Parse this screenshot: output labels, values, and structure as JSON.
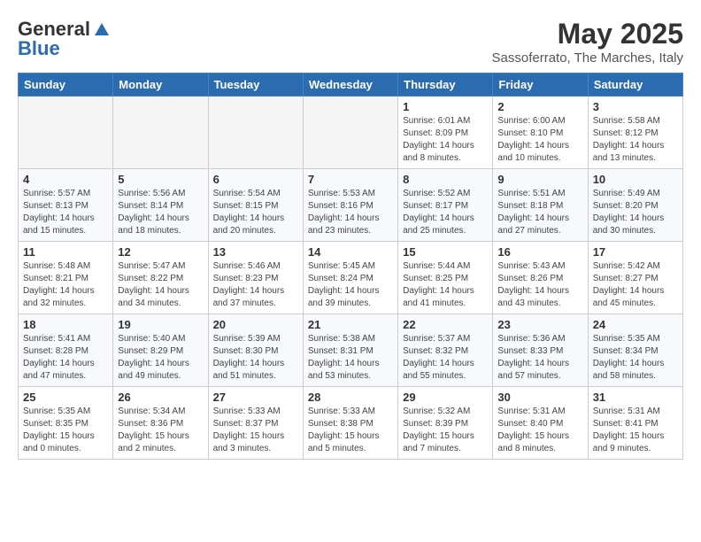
{
  "header": {
    "logo_general": "General",
    "logo_blue": "Blue",
    "month_title": "May 2025",
    "location": "Sassoferrato, The Marches, Italy"
  },
  "days_of_week": [
    "Sunday",
    "Monday",
    "Tuesday",
    "Wednesday",
    "Thursday",
    "Friday",
    "Saturday"
  ],
  "weeks": [
    [
      {
        "day": "",
        "info": ""
      },
      {
        "day": "",
        "info": ""
      },
      {
        "day": "",
        "info": ""
      },
      {
        "day": "",
        "info": ""
      },
      {
        "day": "1",
        "info": "Sunrise: 6:01 AM\nSunset: 8:09 PM\nDaylight: 14 hours\nand 8 minutes."
      },
      {
        "day": "2",
        "info": "Sunrise: 6:00 AM\nSunset: 8:10 PM\nDaylight: 14 hours\nand 10 minutes."
      },
      {
        "day": "3",
        "info": "Sunrise: 5:58 AM\nSunset: 8:12 PM\nDaylight: 14 hours\nand 13 minutes."
      }
    ],
    [
      {
        "day": "4",
        "info": "Sunrise: 5:57 AM\nSunset: 8:13 PM\nDaylight: 14 hours\nand 15 minutes."
      },
      {
        "day": "5",
        "info": "Sunrise: 5:56 AM\nSunset: 8:14 PM\nDaylight: 14 hours\nand 18 minutes."
      },
      {
        "day": "6",
        "info": "Sunrise: 5:54 AM\nSunset: 8:15 PM\nDaylight: 14 hours\nand 20 minutes."
      },
      {
        "day": "7",
        "info": "Sunrise: 5:53 AM\nSunset: 8:16 PM\nDaylight: 14 hours\nand 23 minutes."
      },
      {
        "day": "8",
        "info": "Sunrise: 5:52 AM\nSunset: 8:17 PM\nDaylight: 14 hours\nand 25 minutes."
      },
      {
        "day": "9",
        "info": "Sunrise: 5:51 AM\nSunset: 8:18 PM\nDaylight: 14 hours\nand 27 minutes."
      },
      {
        "day": "10",
        "info": "Sunrise: 5:49 AM\nSunset: 8:20 PM\nDaylight: 14 hours\nand 30 minutes."
      }
    ],
    [
      {
        "day": "11",
        "info": "Sunrise: 5:48 AM\nSunset: 8:21 PM\nDaylight: 14 hours\nand 32 minutes."
      },
      {
        "day": "12",
        "info": "Sunrise: 5:47 AM\nSunset: 8:22 PM\nDaylight: 14 hours\nand 34 minutes."
      },
      {
        "day": "13",
        "info": "Sunrise: 5:46 AM\nSunset: 8:23 PM\nDaylight: 14 hours\nand 37 minutes."
      },
      {
        "day": "14",
        "info": "Sunrise: 5:45 AM\nSunset: 8:24 PM\nDaylight: 14 hours\nand 39 minutes."
      },
      {
        "day": "15",
        "info": "Sunrise: 5:44 AM\nSunset: 8:25 PM\nDaylight: 14 hours\nand 41 minutes."
      },
      {
        "day": "16",
        "info": "Sunrise: 5:43 AM\nSunset: 8:26 PM\nDaylight: 14 hours\nand 43 minutes."
      },
      {
        "day": "17",
        "info": "Sunrise: 5:42 AM\nSunset: 8:27 PM\nDaylight: 14 hours\nand 45 minutes."
      }
    ],
    [
      {
        "day": "18",
        "info": "Sunrise: 5:41 AM\nSunset: 8:28 PM\nDaylight: 14 hours\nand 47 minutes."
      },
      {
        "day": "19",
        "info": "Sunrise: 5:40 AM\nSunset: 8:29 PM\nDaylight: 14 hours\nand 49 minutes."
      },
      {
        "day": "20",
        "info": "Sunrise: 5:39 AM\nSunset: 8:30 PM\nDaylight: 14 hours\nand 51 minutes."
      },
      {
        "day": "21",
        "info": "Sunrise: 5:38 AM\nSunset: 8:31 PM\nDaylight: 14 hours\nand 53 minutes."
      },
      {
        "day": "22",
        "info": "Sunrise: 5:37 AM\nSunset: 8:32 PM\nDaylight: 14 hours\nand 55 minutes."
      },
      {
        "day": "23",
        "info": "Sunrise: 5:36 AM\nSunset: 8:33 PM\nDaylight: 14 hours\nand 57 minutes."
      },
      {
        "day": "24",
        "info": "Sunrise: 5:35 AM\nSunset: 8:34 PM\nDaylight: 14 hours\nand 58 minutes."
      }
    ],
    [
      {
        "day": "25",
        "info": "Sunrise: 5:35 AM\nSunset: 8:35 PM\nDaylight: 15 hours\nand 0 minutes."
      },
      {
        "day": "26",
        "info": "Sunrise: 5:34 AM\nSunset: 8:36 PM\nDaylight: 15 hours\nand 2 minutes."
      },
      {
        "day": "27",
        "info": "Sunrise: 5:33 AM\nSunset: 8:37 PM\nDaylight: 15 hours\nand 3 minutes."
      },
      {
        "day": "28",
        "info": "Sunrise: 5:33 AM\nSunset: 8:38 PM\nDaylight: 15 hours\nand 5 minutes."
      },
      {
        "day": "29",
        "info": "Sunrise: 5:32 AM\nSunset: 8:39 PM\nDaylight: 15 hours\nand 7 minutes."
      },
      {
        "day": "30",
        "info": "Sunrise: 5:31 AM\nSunset: 8:40 PM\nDaylight: 15 hours\nand 8 minutes."
      },
      {
        "day": "31",
        "info": "Sunrise: 5:31 AM\nSunset: 8:41 PM\nDaylight: 15 hours\nand 9 minutes."
      }
    ]
  ]
}
